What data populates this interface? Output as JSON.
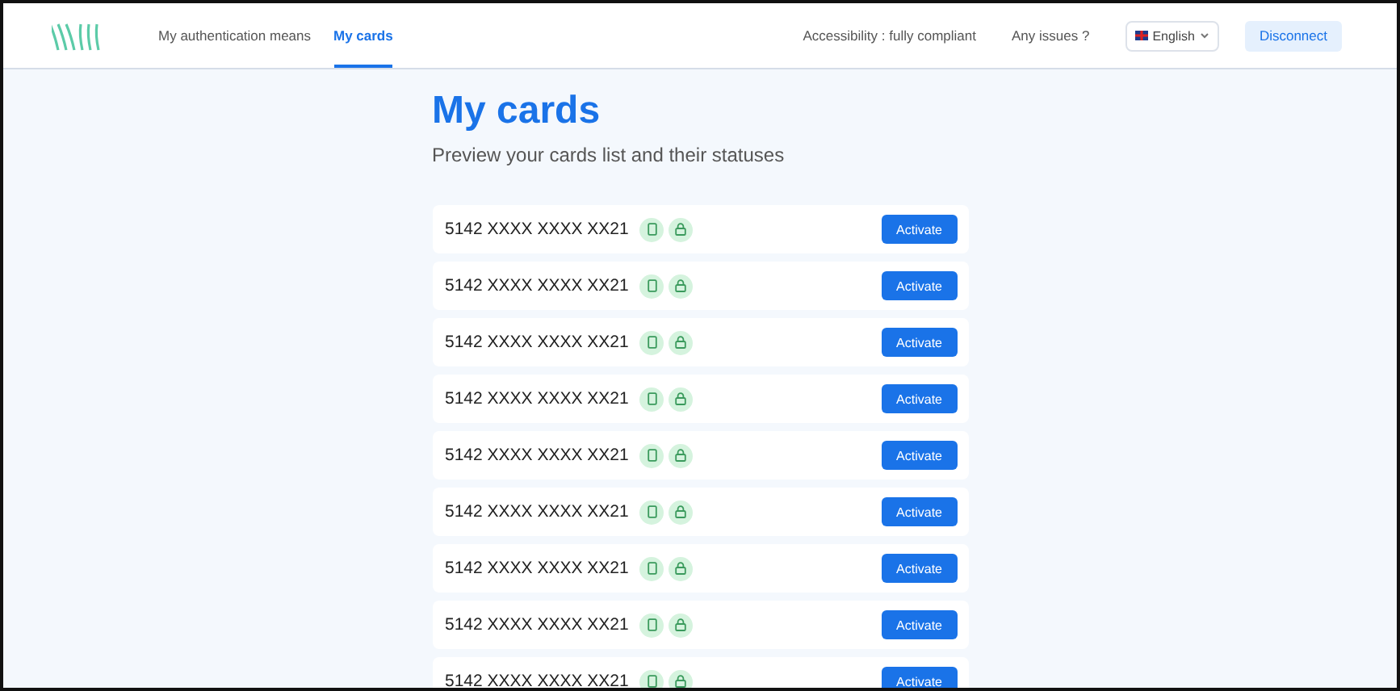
{
  "nav": {
    "items": [
      {
        "label": "My authentication means",
        "selected": false
      },
      {
        "label": "My cards",
        "selected": true
      }
    ],
    "links": [
      "Accessibility : fully compliant",
      "Any issues ?"
    ],
    "language": "English",
    "disconnect": "Disconnect"
  },
  "title": "My cards",
  "subtitle": "Preview your cards list and their statuses",
  "cards": [
    {
      "number": "5142 XXXX XXXX XX21",
      "action": "Activate"
    },
    {
      "number": "5142 XXXX XXXX XX21",
      "action": "Activate"
    },
    {
      "number": "5142 XXXX XXXX XX21",
      "action": "Activate"
    },
    {
      "number": "5142 XXXX XXXX XX21",
      "action": "Activate"
    },
    {
      "number": "5142 XXXX XXXX XX21",
      "action": "Activate"
    },
    {
      "number": "5142 XXXX XXXX XX21",
      "action": "Activate"
    },
    {
      "number": "5142 XXXX XXXX XX21",
      "action": "Activate"
    },
    {
      "number": "5142 XXXX XXXX XX21",
      "action": "Activate"
    },
    {
      "number": "5142 XXXX XXXX XX21",
      "action": "Activate"
    }
  ]
}
